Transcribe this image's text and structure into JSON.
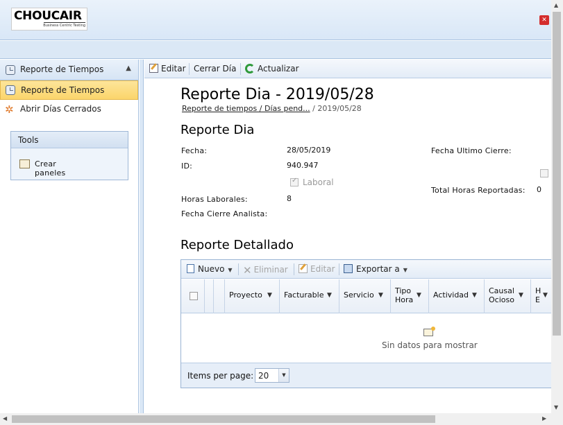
{
  "header": {
    "logo_text": "CHOUCAIR",
    "logo_tagline": "Business Centric Testing",
    "exit_icon": "exit-icon"
  },
  "sidebar": {
    "section_title": "Reporte de Tiempos",
    "items": [
      {
        "label": "Reporte de Tiempos",
        "icon": "clock-icon",
        "active": true
      },
      {
        "label": "Abrir Días Cerrados",
        "icon": "gear-icon",
        "active": false
      }
    ],
    "tools": {
      "title": "Tools",
      "items": [
        {
          "label": "Crear paneles",
          "icon": "panel-icon"
        }
      ]
    }
  },
  "toolbar": {
    "edit_label": "Editar",
    "close_day_label": "Cerrar Día",
    "refresh_label": "Actualizar"
  },
  "page": {
    "title": "Reporte Dia - 2019/05/28",
    "breadcrumb": {
      "link": "Reporte de tiempos / Días pend...",
      "separator": "/",
      "current": "2019/05/28"
    }
  },
  "report": {
    "section_title": "Reporte Dia",
    "fecha_label": "Fecha:",
    "fecha_value": "28/05/2019",
    "id_label": "ID:",
    "id_value": "940.947",
    "laboral_label": "Laboral",
    "horas_label": "Horas Laborales:",
    "horas_value": "8",
    "cierre_analista_label": "Fecha Cierre Analista:",
    "cierre_analista_value": "",
    "ultimo_cierre_label": "Fecha Ultimo Cierre:",
    "ultimo_cierre_value": "",
    "total_horas_label": "Total Horas Reportadas:",
    "total_horas_value": "0"
  },
  "detail": {
    "section_title": "Reporte Detallado",
    "grid_toolbar": {
      "new_label": "Nuevo",
      "delete_label": "Eliminar",
      "edit_label": "Editar",
      "export_label": "Exportar a"
    },
    "columns": [
      {
        "label": "Proyecto"
      },
      {
        "label": "Facturable"
      },
      {
        "label": "Servicio"
      },
      {
        "label": "Tipo Hora",
        "line1": "Tipo",
        "line2": "Hora"
      },
      {
        "label": "Actividad"
      },
      {
        "label": "Causal Ocioso",
        "line1": "Causal",
        "line2": "Ocioso"
      },
      {
        "label": "H E",
        "line1": "H",
        "line2": "E"
      }
    ],
    "empty_text": "Sin datos para mostrar",
    "pager": {
      "items_per_page_label": "Items per page:",
      "items_per_page_value": "20"
    }
  }
}
